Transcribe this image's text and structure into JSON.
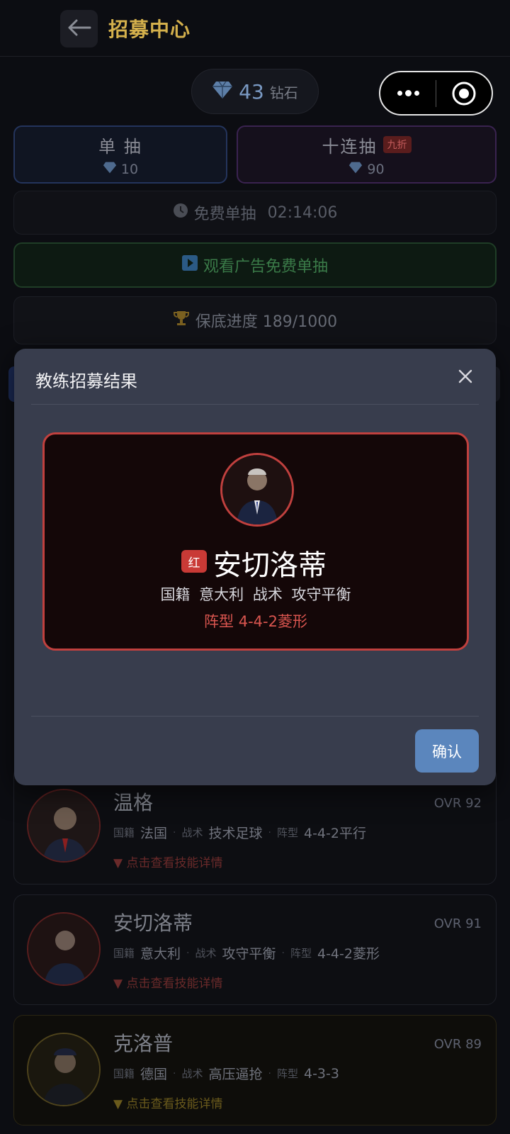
{
  "header": {
    "title": "招募中心"
  },
  "currency": {
    "amount": "43",
    "unit": "钻石"
  },
  "draw": {
    "single": {
      "label": "单 抽",
      "cost": "10"
    },
    "ten": {
      "label": "十连抽",
      "discount": "九折",
      "cost": "90"
    }
  },
  "free_draw": {
    "label": "免费单抽",
    "timer": "02:14:06"
  },
  "ad_draw": {
    "label": "观看广告免费单抽"
  },
  "pity": {
    "label": "保底进度 189/1000"
  },
  "meta_labels": {
    "nationality": "国籍",
    "tactic": "战术",
    "formation": "阵型",
    "skill_link": "▼ 点击查看技能详情"
  },
  "coaches": [
    {
      "name": "温格",
      "ovr": "OVR 92",
      "nationality": "法国",
      "tactic": "技术足球",
      "formation": "4-4-2平行"
    },
    {
      "name": "安切洛蒂",
      "ovr": "OVR 91",
      "nationality": "意大利",
      "tactic": "攻守平衡",
      "formation": "4-4-2菱形"
    },
    {
      "name": "克洛普",
      "ovr": "OVR 89",
      "nationality": "德国",
      "tactic": "高压逼抢",
      "formation": "4-3-3"
    }
  ],
  "modal": {
    "title": "教练招募结果",
    "result": {
      "rarity": "红",
      "name": "安切洛蒂",
      "meta": "国籍 意大利  战术 攻守平衡",
      "formation": "阵型 4-4-2菱形"
    },
    "confirm": "确认"
  },
  "colors": {
    "rarity_red": "#c93a36",
    "gold": "#d4b04c",
    "confirm_blue": "#5b86bd"
  }
}
